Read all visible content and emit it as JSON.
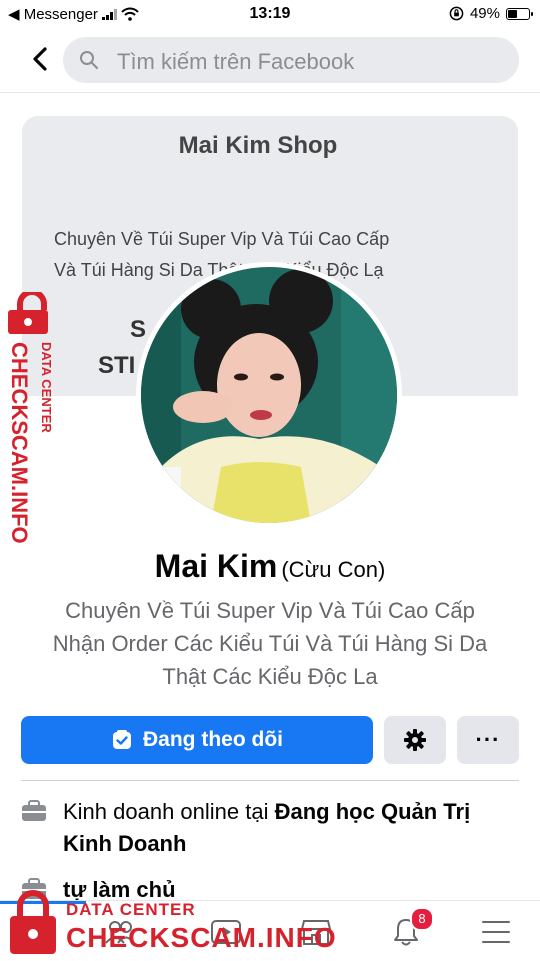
{
  "status_bar": {
    "back_app": "◀ Messenger",
    "time": "13:19",
    "battery": "49%",
    "battery_level": 0.49
  },
  "search": {
    "placeholder": "Tìm kiếm trên Facebook"
  },
  "cover": {
    "title": "Mai Kim Shop",
    "line1": "Chuyên Về Túi Super Vip Và Túi Cao Cấp",
    "line2": "Và Túi Hàng Si Da Thật Các Kiểu Độc Lạ",
    "big1": "S",
    "big2": "STI"
  },
  "profile": {
    "name": "Mai Kim",
    "alternate_name": "(Cừu Con)",
    "bio_lines": [
      "Chuyên Về Túi Super Vip Và Túi Cao Cấp",
      "Nhận Order Các Kiểu Túi Và Túi Hàng Si Da",
      "Thật Các Kiểu Độc La"
    ]
  },
  "actions": {
    "follow_label": "Đang theo dõi",
    "more_label": "···"
  },
  "intro": [
    {
      "prefix": "Kinh doanh online tại ",
      "bold": "Đang học Quản Trị Kinh Doanh",
      "icon": "briefcase-icon"
    },
    {
      "prefix": "",
      "bold": "tự làm chủ",
      "icon": "briefcase-icon"
    }
  ],
  "bottom_nav": {
    "notifications_badge": "8",
    "items": [
      "home-icon",
      "friends-icon",
      "watch-icon",
      "marketplace-icon",
      "bell-icon",
      "menu-icon"
    ]
  },
  "watermark": {
    "small": "DATA CENTER",
    "brand": "CHECKSCAM.INFO"
  },
  "colors": {
    "primary": "#1877f2",
    "watermark": "#d6222d",
    "badge": "#e41e3f"
  }
}
